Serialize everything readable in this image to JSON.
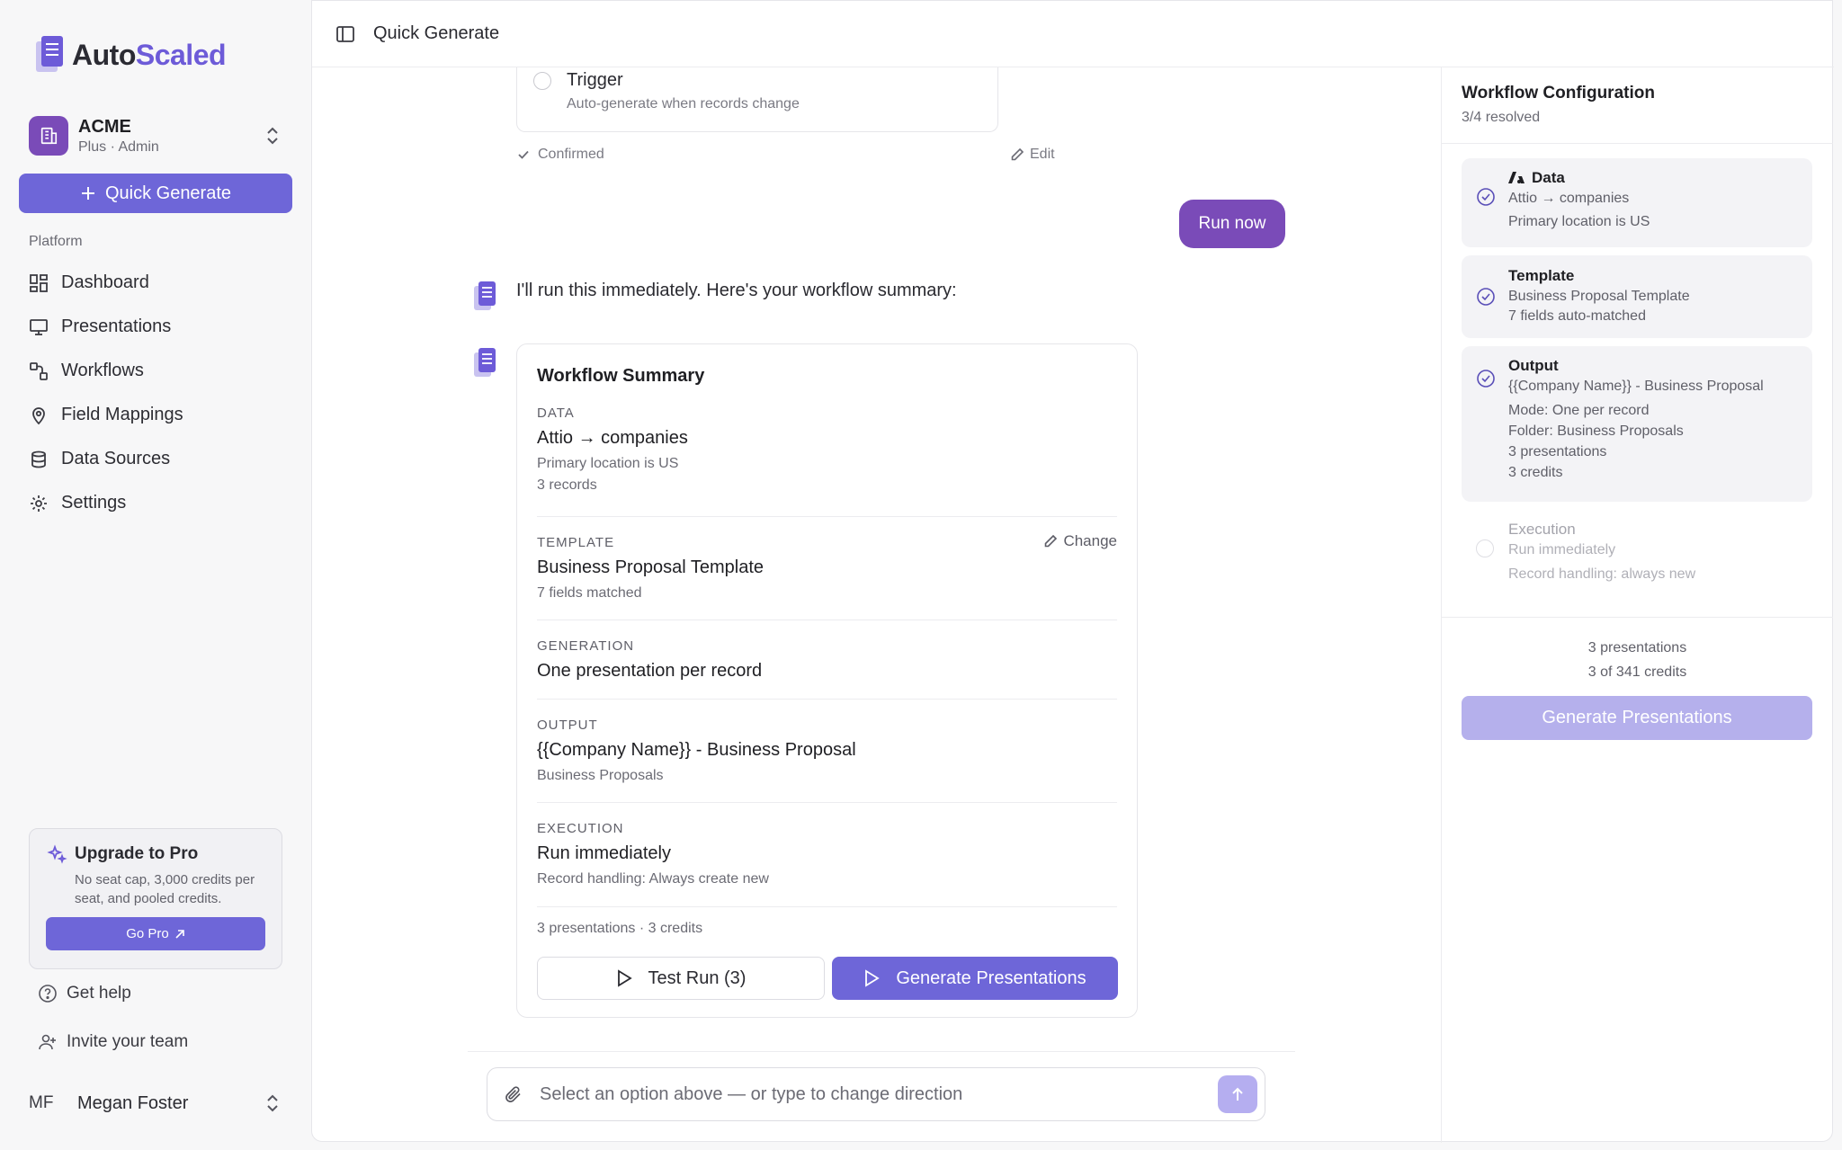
{
  "app": {
    "logo_prefix": "Auto",
    "logo_suffix": "Scaled"
  },
  "org": {
    "name": "ACME",
    "plan": "Plus · Admin"
  },
  "sidebar": {
    "quick_generate": "Quick Generate",
    "section_label": "Platform",
    "items": [
      {
        "label": "Dashboard",
        "icon": "dashboard-icon"
      },
      {
        "label": "Presentations",
        "icon": "presentation-icon"
      },
      {
        "label": "Workflows",
        "icon": "workflow-icon"
      },
      {
        "label": "Field Mappings",
        "icon": "map-pin-icon"
      },
      {
        "label": "Data Sources",
        "icon": "database-icon"
      },
      {
        "label": "Settings",
        "icon": "gear-icon"
      }
    ],
    "upgrade": {
      "title": "Upgrade to Pro",
      "desc": "No seat cap, 3,000 credits per seat, and pooled credits.",
      "button": "Go Pro"
    },
    "get_help": "Get help",
    "invite": "Invite your team",
    "user": {
      "initials": "MF",
      "name": "Megan Foster"
    }
  },
  "topbar": {
    "title": "Quick Generate"
  },
  "chat": {
    "trigger": {
      "title": "Trigger",
      "desc": "Auto-generate when records change",
      "confirmed": "Confirmed",
      "edit": "Edit"
    },
    "user_message": "Run now",
    "bot_message": "I'll run this immediately. Here's your workflow summary:",
    "summary": {
      "title": "Workflow Summary",
      "data_label": "DATA",
      "data_main": "Attio → companies",
      "data_filter": "Primary location is US",
      "data_count": "3 records",
      "template_label": "TEMPLATE",
      "template_main": "Business Proposal Template",
      "template_sub": "7 fields matched",
      "change": "Change",
      "generation_label": "GENERATION",
      "generation_main": "One presentation per record",
      "output_label": "OUTPUT",
      "output_main": "{{Company Name}} - Business Proposal",
      "output_sub": "Business Proposals",
      "execution_label": "EXECUTION",
      "execution_main": "Run immediately",
      "execution_sub": "Record handling: Always create new",
      "totals": "3 presentations · 3 credits",
      "test_run": "Test Run (3)",
      "generate": "Generate Presentations"
    },
    "composer_placeholder": "Select an option above — or type to change direction"
  },
  "config": {
    "title": "Workflow Configuration",
    "resolved": "3/4 resolved",
    "data": {
      "head": "Data",
      "line1": "Attio → companies",
      "line2": "Primary location is US"
    },
    "template": {
      "head": "Template",
      "line1": "Business Proposal Template",
      "line2": "7 fields auto-matched"
    },
    "output": {
      "head": "Output",
      "line1": "{{Company Name}} - Business Proposal",
      "line2": "Mode: One per record",
      "line3": "Folder: Business Proposals",
      "line4": "3 presentations",
      "line5": "3 credits"
    },
    "execution": {
      "head": "Execution",
      "line1": "Run immediately",
      "line2": "Record handling: always new"
    },
    "totals_line1": "3 presentations",
    "totals_line2": "3 of 341 credits",
    "generate": "Generate Presentations"
  },
  "colors": {
    "accent": "#6e66d8",
    "brand_purple": "#7a4bb8",
    "disabled_accent": "#b5b0ec"
  }
}
